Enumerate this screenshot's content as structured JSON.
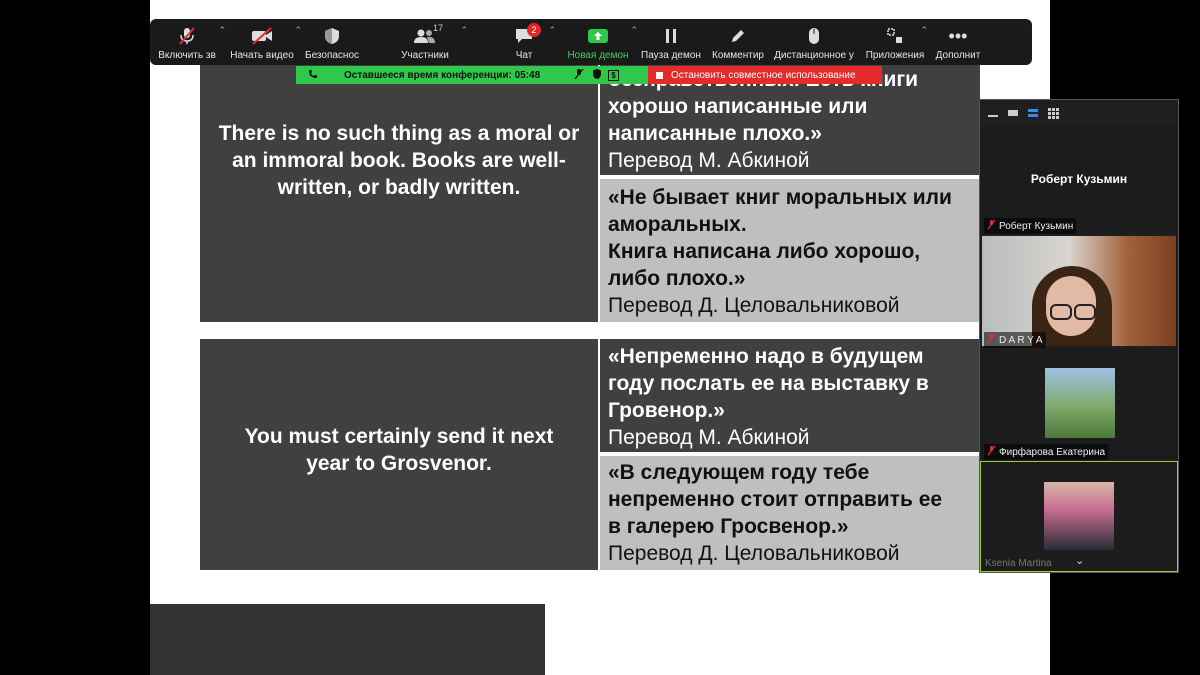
{
  "slide": {
    "row1": {
      "english": "There is no such thing as a moral or an immoral book. Books are well-written, or badly written.",
      "ru1_lines": [
        "безнравственных. Есть книги",
        "хорошо написанные или",
        "написанные плохо.»"
      ],
      "ru1_credit": "Перевод  М. Абкиной",
      "ru2_lines": [
        "«Не бывает книг моральных или",
        "аморальных.",
        "Книга написана либо хорошо,",
        "либо плохо.»"
      ],
      "ru2_credit": "Перевод Д. Целовальниковой"
    },
    "row2": {
      "english": "You must certainly send it next year to Grosvenor.",
      "ru1_lines": [
        "«Непременно надо в будущем",
        "году послать ее на выставку в",
        "Гровенор.»"
      ],
      "ru1_credit": "Перевод  М. Абкиной",
      "ru2_lines": [
        "«В следующем году тебе",
        "непременно стоит отправить ее",
        "в галерею Гросвенор.»"
      ],
      "ru2_credit": "Перевод Д. Целовальниковой"
    }
  },
  "toolbar": {
    "unmute": "Включить зв",
    "start_video": "Начать видео",
    "security": "Безопаснос",
    "participants": "Участники",
    "participants_count": "17",
    "chat": "Чат",
    "chat_badge": "2",
    "new_share": "Новая демон",
    "pause_share": "Пауза демон",
    "annotate": "Комментир",
    "remote_control": "Дистанционное у",
    "apps": "Приложения",
    "more": "Дополнит"
  },
  "share_bar": {
    "time_left": "Оставшееся время конференции: 05:48",
    "stop_share": "Остановить совместное использование"
  },
  "panel": {
    "speaker_name": "Роберт Кузьмин",
    "tiles": [
      {
        "name": "Роберт Кузьмин"
      },
      {
        "name": "D A R Y A"
      },
      {
        "name": "Фирфарова Екатерина"
      },
      {
        "name": "Ksenia Martina"
      }
    ]
  },
  "colors": {
    "share_green": "#2ec84a",
    "stop_red": "#e42a2a",
    "slide_dark": "#404040",
    "slide_light": "#bfbfbf"
  }
}
